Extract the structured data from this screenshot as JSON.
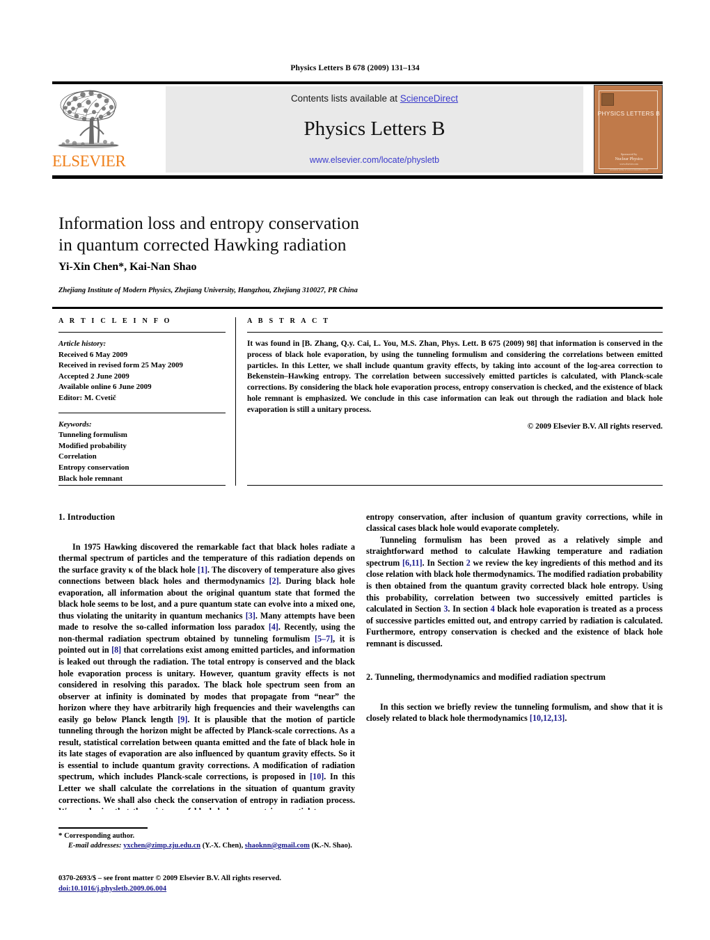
{
  "running_head": "Physics Letters B 678 (2009) 131–134",
  "masthead": {
    "contents_prefix": "Contents lists available at ",
    "sciencedirect": "ScienceDirect",
    "journal_title": "Physics Letters B",
    "journal_url": "www.elsevier.com/locate/physletb",
    "publisher_wordmark": "ELSEVIER",
    "publisher_color": "#ef7f1a",
    "link_color": "#3a3acc",
    "cover": {
      "title": "PHYSICS LETTERS B",
      "foot1": "Sponsored by",
      "foot2": "Nuclear Physics",
      "foot3": "www.elsevier.com",
      "foot4": "Available online at www.sciencedirect.com",
      "background": "#c07a4a"
    }
  },
  "article": {
    "title": "Information loss and entropy conservation\nin quantum corrected Hawking radiation",
    "title_line1": "Information loss and entropy conservation",
    "title_line2": "in quantum corrected Hawking radiation",
    "authors": "Yi-Xin Chen*, Kai-Nan Shao",
    "affiliation": "Zhejiang Institute of Modern Physics, Zhejiang University, Hangzhou, Zhejiang 310027, PR China"
  },
  "article_info": {
    "heading": "A R T I C L E   I N F O",
    "history_label": "Article history:",
    "history": [
      "Received 6 May 2009",
      "Received in revised form 25 May 2009",
      "Accepted 2 June 2009",
      "Available online 6 June 2009",
      "Editor: M. Cvetič"
    ],
    "keywords_label": "Keywords:",
    "keywords": [
      "Tunneling formulism",
      "Modified probability",
      "Correlation",
      "Entropy conservation",
      "Black hole remnant"
    ]
  },
  "abstract": {
    "heading": "A B S T R A C T",
    "text": "It was found in [B. Zhang, Q.y. Cai, L. You, M.S. Zhan, Phys. Lett. B 675 (2009) 98] that information is conserved in the process of black hole evaporation, by using the tunneling formulism and considering the correlations between emitted particles. In this Letter, we shall include quantum gravity effects, by taking into account of the log-area correction to Bekenstein–Hawking entropy. The correlation between successively emitted particles is calculated, with Planck-scale corrections. By considering the black hole evaporation process, entropy conservation is checked, and the existence of black hole remnant is emphasized. We conclude in this case information can leak out through the radiation and black hole evaporation is still a unitary process.",
    "copyright": "© 2009 Elsevier B.V. All rights reserved."
  },
  "body": {
    "section1_heading": "1. Introduction",
    "section1_paragraphs": [
      {
        "parts": [
          {
            "t": "In 1975 Hawking discovered the remarkable fact that black holes radiate a thermal spectrum of particles and the temperature of this radiation depends on the surface gravity κ of the black hole "
          },
          {
            "t": "[1]",
            "ref": true
          },
          {
            "t": ". The discovery of temperature also gives connections between black holes and thermodynamics "
          },
          {
            "t": "[2]",
            "ref": true
          },
          {
            "t": ". During black hole evaporation, all information about the original quantum state that formed the black hole seems to be lost, and a pure quantum state can evolve into a mixed one, thus violating the unitarity in quantum mechanics "
          },
          {
            "t": "[3]",
            "ref": true
          },
          {
            "t": ". Many attempts have been made to resolve the so-called information loss paradox "
          },
          {
            "t": "[4]",
            "ref": true
          },
          {
            "t": ". Recently, using the non-thermal radiation spectrum obtained by tunneling formulism "
          },
          {
            "t": "[5–7]",
            "ref": true
          },
          {
            "t": ", it is pointed out in "
          },
          {
            "t": "[8]",
            "ref": true
          },
          {
            "t": " that correlations exist among emitted particles, and information is leaked out through the radiation. The total entropy is conserved and the black hole evaporation process is unitary. However, quantum gravity effects is not considered in resolving this paradox. The black hole spectrum seen from an observer at infinity is dominated by modes that propagate from “near” the horizon where they have arbitrarily high frequencies and their wavelengths can easily go below Planck length "
          },
          {
            "t": "[9]",
            "ref": true
          },
          {
            "t": ". It is plausible that the motion of particle tunneling through the horizon might be affected by Planck-scale corrections. As a result, statistical correlation between quanta emitted and the fate of black hole in its late stages of evaporation are also influenced by quantum gravity effects. So it is essential to include quantum gravity corrections. A modification of radiation spectrum, which includes Planck-scale corrections, is proposed in "
          },
          {
            "t": "[10]",
            "ref": true
          },
          {
            "t": ". In this Letter we shall calculate the correlations in the situation of quantum gravity corrections. We shall also check the conservation of entropy in radiation process. We emphasize that the existence of black hole remnant is essential to preserve entropy conservation, after inclusion of quantum gravity corrections, while in classical cases black hole would evaporate completely."
          }
        ]
      },
      {
        "parts": [
          {
            "t": "Tunneling formulism has been proved as a relatively simple and straightforward method to calculate Hawking temperature and radiation spectrum "
          },
          {
            "t": "[6,11]",
            "ref": true
          },
          {
            "t": ". In Section "
          },
          {
            "t": "2",
            "ref": true
          },
          {
            "t": " we review the key ingredients of this method and its close relation with black hole thermodynamics. The modified radiation probability is then obtained from the quantum gravity corrected black hole entropy. Using this probability, correlation between two successively emitted particles is calculated in Section "
          },
          {
            "t": "3",
            "ref": true
          },
          {
            "t": ". In section "
          },
          {
            "t": "4",
            "ref": true
          },
          {
            "t": " black hole evaporation is treated as a process of successive particles emitted out, and entropy carried by radiation is calculated. Furthermore, entropy conservation is checked and the existence of black hole remnant is discussed."
          }
        ]
      }
    ],
    "section2_heading": "2. Tunneling, thermodynamics and modified radiation spectrum",
    "section2_paragraphs": [
      {
        "parts": [
          {
            "t": "In this section we briefly review the tunneling formulism, and show that it is closely related to black hole thermodynamics "
          },
          {
            "t": "[10,12,13]",
            "ref": true
          },
          {
            "t": "."
          }
        ]
      }
    ]
  },
  "footnote": {
    "marker": "*",
    "corresponding": "Corresponding author.",
    "email_label": "E-mail addresses:",
    "email1": "yxchen@zimp.zju.edu.cn",
    "email1_author": "(Y.-X. Chen),",
    "email2": "shaoknn@gmail.com",
    "email2_author": "(K.-N. Shao)."
  },
  "imprint": {
    "line1": "0370-2693/$ – see front matter © 2009 Elsevier B.V. All rights reserved.",
    "doi": "doi:10.1016/j.physletb.2009.06.004"
  }
}
